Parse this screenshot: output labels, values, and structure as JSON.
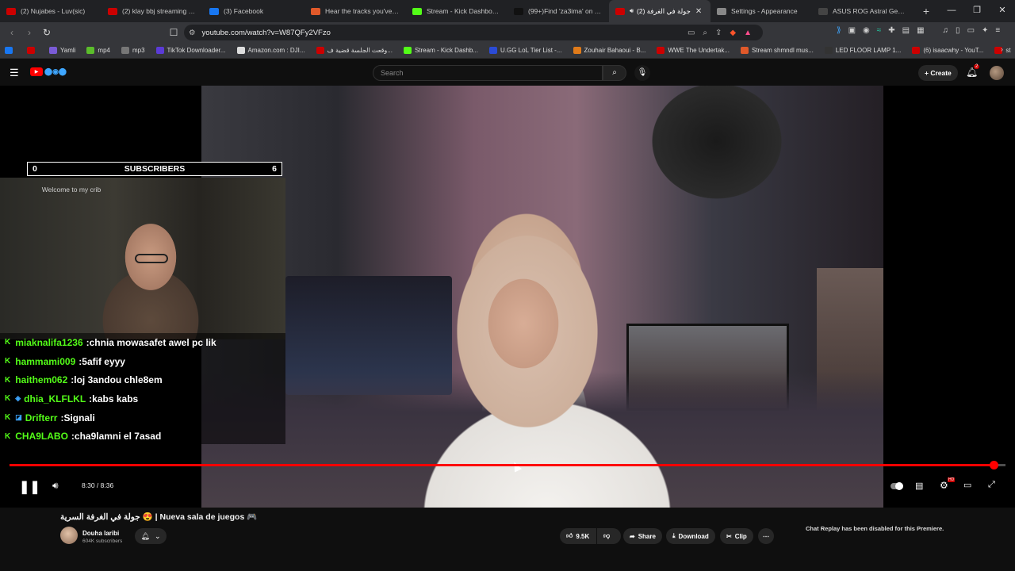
{
  "browser": {
    "tabs": [
      {
        "title": "(2) Nujabes - Luv(sic) ",
        "color": "#cc0000",
        "active": false
      },
      {
        "title": "(2) klay bbj streaming - Yo",
        "color": "#cc0000",
        "active": false
      },
      {
        "title": "(3) Facebook",
        "color": "#1877f2",
        "active": false
      },
      {
        "title": "Hear the tracks you've like",
        "color": "#e0592a",
        "active": false
      },
      {
        "title": "Stream - Kick Dashboard",
        "color": "#53fc18",
        "active": false
      },
      {
        "title": "(99+)Find 'za3ima' on TikT",
        "color": "#111111",
        "active": false
      },
      {
        "title": "(2) جولة في الغرفة",
        "color": "#cc0000",
        "active": true
      },
      {
        "title": "Settings - Appearance",
        "color": "#888888",
        "active": false
      },
      {
        "title": "ASUS ROG Astral GeForce",
        "color": "#444444",
        "active": false
      }
    ],
    "new_tab": "+",
    "window_controls": [
      "—",
      "❐",
      "✕"
    ],
    "url": "youtube.com/watch?v=W87QFy2VFzo",
    "bookmarks": [
      {
        "label": "",
        "color": "#1877f2"
      },
      {
        "label": "",
        "color": "#cc0000"
      },
      {
        "label": "Yamli",
        "color": "#7a5bd6"
      },
      {
        "label": "mp4",
        "color": "#5bbd2b"
      },
      {
        "label": "mp3",
        "color": "#777777"
      },
      {
        "label": "TikTok Downloader...",
        "color": "#5b3bd6"
      },
      {
        "label": "Amazon.com : DJI...",
        "color": "#dddddd"
      },
      {
        "label": "وقعت الجلسة قضية ف...",
        "color": "#cc0000"
      },
      {
        "label": "Stream - Kick Dashb...",
        "color": "#53fc18"
      },
      {
        "label": "U.GG LoL Tier List -...",
        "color": "#2b4bd6"
      },
      {
        "label": "Zouhair Bahaoui - B...",
        "color": "#e07b1a"
      },
      {
        "label": "WWE The Undertak...",
        "color": "#cc0000"
      },
      {
        "label": "Stream shmndl mus...",
        "color": "#e0592a"
      },
      {
        "label": "LED FLOOR LAMP 1...",
        "color": "#333333"
      },
      {
        "label": "(6) isaacwhy - YouT...",
        "color": "#cc0000"
      },
      {
        "label": "st",
        "color": "#cc0000"
      }
    ]
  },
  "youtube": {
    "search_placeholder": "Search",
    "create_label": "Create",
    "notification_count": "2"
  },
  "overlay": {
    "subscribers_left": "0",
    "subscribers_label": "SUBSCRIBERS",
    "subscribers_right": "6",
    "webcam_sign": "Welcome to my crib",
    "chat": [
      {
        "user": "miaknalifa1236",
        "message": "chnia mowasafet awel pc lik",
        "badge": ""
      },
      {
        "user": "hammami009",
        "message": "5afif eyyy",
        "badge": ""
      },
      {
        "user": "haithem062",
        "message": "loj 3andou chle8em",
        "badge": ""
      },
      {
        "user": "dhia_KLFLKL",
        "message": "kabs kabs",
        "badge": "◈"
      },
      {
        "user": "Drifterr",
        "message": "Signali",
        "badge": "◪"
      },
      {
        "user": "CHA9LABO",
        "message": "cha9lamni el 7asad",
        "badge": ""
      }
    ]
  },
  "player": {
    "current_time": "8:30",
    "duration": "8:36",
    "time_display": "8:30 / 8:36",
    "progress": 0.988,
    "hd_badge": "HD"
  },
  "video_info": {
    "title": "جولة في الغرفة السرية 😍 | Nueva sala de juegos 🎮",
    "channel_name": "Douha laribi",
    "subscribers": "604K subscribers",
    "likes": "9.5K",
    "share_label": "Share",
    "download_label": "Download",
    "clip_label": "Clip",
    "chat_replay_notice": "Chat Replay has been disabled for this Premiere."
  },
  "colors": {
    "accent_red": "#ff0000",
    "kick_green": "#53fc18",
    "background": "#0f0f0f"
  }
}
